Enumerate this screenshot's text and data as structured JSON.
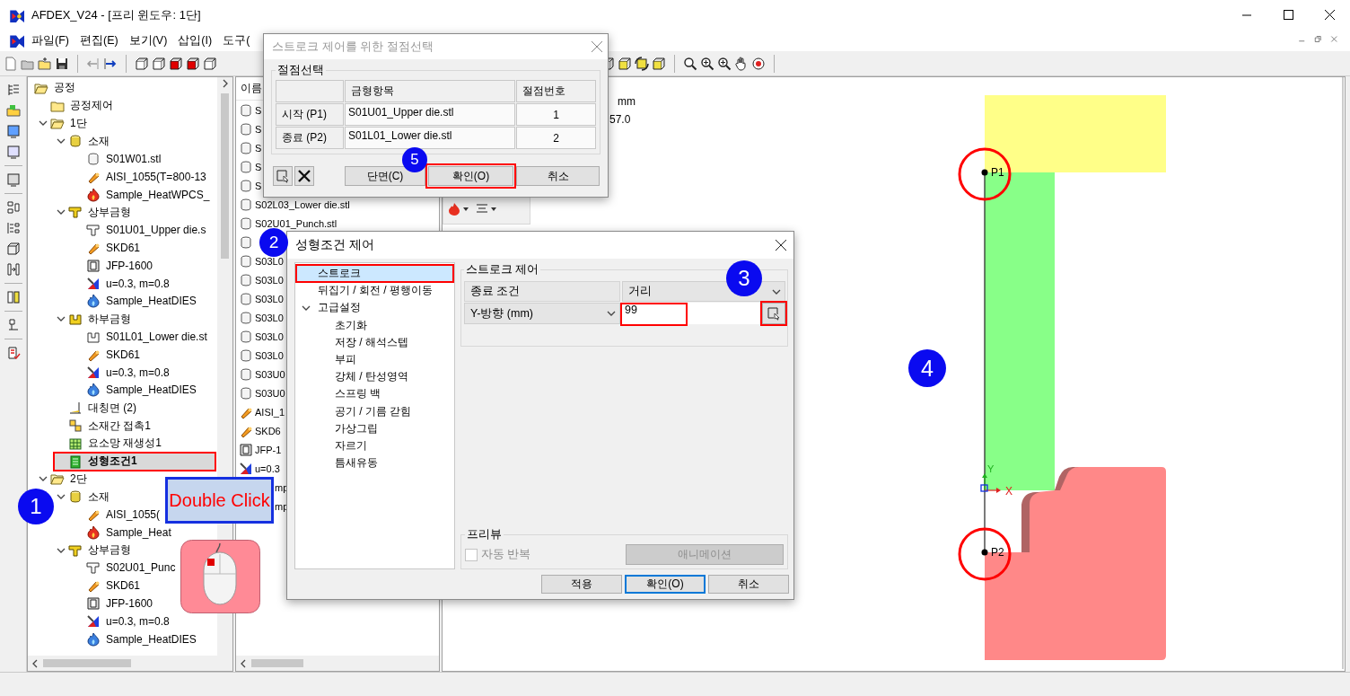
{
  "window": {
    "title": "AFDEX_V24 - [프리 윈도우: 1단]"
  },
  "menu": [
    {
      "label": "파일(F)"
    },
    {
      "label": "편집(E)"
    },
    {
      "label": "보기(V)"
    },
    {
      "label": "삽입(I)"
    },
    {
      "label": "도구("
    }
  ],
  "process_tree": {
    "items": [
      {
        "label": "공정",
        "kind": "folder",
        "selected": false,
        "highlighted": false,
        "expanded": true,
        "children": [
          {
            "label": "공정제어",
            "kind": "folder",
            "selected": false,
            "highlighted": false
          },
          {
            "label": "1단",
            "kind": "folder",
            "selected": false,
            "highlighted": false,
            "expanded": true,
            "children": [
              {
                "label": "소재",
                "kind": "solid",
                "selected": false,
                "highlighted": false,
                "expanded": true,
                "children": [
                  {
                    "label": "S01W01.stl",
                    "kind": "stl",
                    "selected": false,
                    "highlighted": false
                  },
                  {
                    "label": "AISI_1055(T=800-13",
                    "kind": "material",
                    "selected": false,
                    "highlighted": false
                  },
                  {
                    "label": "Sample_HeatWPCS_",
                    "kind": "heat",
                    "selected": false,
                    "highlighted": false
                  }
                ]
              },
              {
                "label": "상부금형",
                "kind": "upper-die",
                "selected": false,
                "highlighted": false,
                "expanded": true,
                "children": [
                  {
                    "label": "S01U01_Upper die.s",
                    "kind": "upper-part",
                    "selected": false,
                    "highlighted": false
                  },
                  {
                    "label": "SKD61",
                    "kind": "material",
                    "selected": false,
                    "highlighted": false
                  },
                  {
                    "label": "JFP-1600",
                    "kind": "press",
                    "selected": false,
                    "highlighted": false
                  },
                  {
                    "label": "u=0.3, m=0.8",
                    "kind": "friction",
                    "selected": false,
                    "highlighted": false
                  },
                  {
                    "label": "Sample_HeatDIES",
                    "kind": "heat-die",
                    "selected": false,
                    "highlighted": false
                  }
                ]
              },
              {
                "label": "하부금형",
                "kind": "lower-die",
                "selected": false,
                "highlighted": false,
                "expanded": true,
                "children": [
                  {
                    "label": "S01L01_Lower die.st",
                    "kind": "lower-part",
                    "selected": false,
                    "highlighted": false
                  },
                  {
                    "label": "SKD61",
                    "kind": "material",
                    "selected": false,
                    "highlighted": false
                  },
                  {
                    "label": "u=0.3, m=0.8",
                    "kind": "friction",
                    "selected": false,
                    "highlighted": false
                  },
                  {
                    "label": "Sample_HeatDIES",
                    "kind": "heat-die",
                    "selected": false,
                    "highlighted": false
                  }
                ]
              },
              {
                "label": "대칭면 (2)",
                "kind": "symmetry",
                "selected": false,
                "highlighted": false
              },
              {
                "label": "소재간 접촉1",
                "kind": "contact",
                "selected": false,
                "highlighted": false
              },
              {
                "label": "요소망 재생성1",
                "kind": "remesh",
                "selected": false,
                "highlighted": false
              },
              {
                "label": "성형조건1",
                "kind": "condition",
                "selected": true,
                "highlighted": true
              }
            ]
          },
          {
            "label": "2단",
            "kind": "folder",
            "selected": false,
            "highlighted": false,
            "expanded": true,
            "children": [
              {
                "label": "소재",
                "kind": "solid",
                "selected": false,
                "highlighted": false,
                "expanded": true,
                "children": [
                  {
                    "label": "AISI_1055(",
                    "kind": "material",
                    "selected": false,
                    "highlighted": false
                  },
                  {
                    "label": "Sample_Heat",
                    "kind": "heat",
                    "selected": false,
                    "highlighted": false
                  }
                ]
              },
              {
                "label": "상부금형",
                "kind": "upper-die",
                "selected": false,
                "highlighted": false,
                "expanded": true,
                "children": [
                  {
                    "label": "S02U01_Punc",
                    "kind": "upper-part",
                    "selected": false,
                    "highlighted": false
                  },
                  {
                    "label": "SKD61",
                    "kind": "material",
                    "selected": false,
                    "highlighted": false
                  },
                  {
                    "label": "JFP-1600",
                    "kind": "press",
                    "selected": false,
                    "highlighted": false
                  },
                  {
                    "label": "u=0.3, m=0.8",
                    "kind": "friction",
                    "selected": false,
                    "highlighted": false
                  },
                  {
                    "label": "Sample_HeatDIES",
                    "kind": "heat-die",
                    "selected": false,
                    "highlighted": false
                  }
                ]
              }
            ]
          }
        ]
      }
    ]
  },
  "file_list": {
    "header": "이름",
    "rows": [
      {
        "label": "S",
        "kind": "stl"
      },
      {
        "label": "S",
        "kind": "stl"
      },
      {
        "label": "S",
        "kind": "stl"
      },
      {
        "label": "S",
        "kind": "stl"
      },
      {
        "label": "S",
        "kind": "stl"
      },
      {
        "label": "S02L03_Lower die.stl",
        "kind": "stl"
      },
      {
        "label": "S02U01_Punch.stl",
        "kind": "stl"
      },
      {
        "kind": "stl"
      },
      {
        "label": "S03L0",
        "kind": "stl"
      },
      {
        "label": "S03L0",
        "kind": "stl"
      },
      {
        "label": "S03L0",
        "kind": "stl"
      },
      {
        "label": "S03L0",
        "kind": "stl"
      },
      {
        "label": "S03L0",
        "kind": "stl"
      },
      {
        "label": "S03L0",
        "kind": "stl"
      },
      {
        "label": "S03U0",
        "kind": "stl"
      },
      {
        "label": "S03U0",
        "kind": "stl"
      },
      {
        "label": "AISI_1",
        "kind": "material"
      },
      {
        "label": "SKD6",
        "kind": "material"
      },
      {
        "label": "JFP-1",
        "kind": "press"
      },
      {
        "label": "u=0.3",
        "kind": "friction"
      },
      {
        "label": "mp",
        "kind": "covered"
      },
      {
        "label": "mp",
        "kind": "covered"
      }
    ]
  },
  "property_fragment": {
    "unit": "mm",
    "value": "57.0"
  },
  "node_dialog": {
    "title": "스트로크 제어를 위한 절점선택",
    "group": "절점선택",
    "columns": [
      "금형항목",
      "절점번호"
    ],
    "rows": [
      {
        "label": "시작 (P1)",
        "die": "S01U01_Upper die.stl",
        "node": "1"
      },
      {
        "label": "종료 (P2)",
        "die": "S01L01_Lower die.stl",
        "node": "2"
      }
    ],
    "buttons": [
      {
        "label": "단면(C)",
        "highlighted": false
      },
      {
        "label": "확인(O)",
        "highlighted": true
      },
      {
        "label": "취소",
        "highlighted": false
      }
    ]
  },
  "condition_dialog": {
    "title": "성형조건 제어",
    "nav": [
      {
        "label": "스트로크",
        "selected": true,
        "highlighted": true
      },
      {
        "label": "뒤집기 / 회전 / 평행이동",
        "selected": false,
        "highlighted": false
      },
      {
        "label": "고급설정",
        "selected": false,
        "highlighted": false,
        "expanded": true,
        "children": [
          {
            "label": "초기화",
            "selected": false,
            "highlighted": false
          },
          {
            "label": "저장 / 해석스텝",
            "selected": false,
            "highlighted": false
          },
          {
            "label": "부피",
            "selected": false,
            "highlighted": false
          },
          {
            "label": "강체 / 탄성영역",
            "selected": false,
            "highlighted": false
          },
          {
            "label": "스프링 백",
            "selected": false,
            "highlighted": false
          },
          {
            "label": "공기 / 기름 갇힘",
            "selected": false,
            "highlighted": false
          },
          {
            "label": "가상그립",
            "selected": false,
            "highlighted": false
          },
          {
            "label": "자르기",
            "selected": false,
            "highlighted": false
          },
          {
            "label": "틈새유동",
            "selected": false,
            "highlighted": false
          }
        ]
      }
    ],
    "stroke_group": {
      "title": "스트로크 제어",
      "end_condition_label": "종료 조건",
      "end_condition": "거리",
      "direction": "Y-방향 (mm)",
      "value": "99",
      "value_highlighted": true,
      "pick_highlighted": true
    },
    "preview_group": {
      "title": "프리뷰",
      "auto_repeat": {
        "label": "자동 반복",
        "checked": false,
        "disabled": true
      },
      "animation": {
        "label": "애니메이션",
        "disabled": true
      }
    },
    "buttons": [
      {
        "label": "적용",
        "default": false
      },
      {
        "label": "확인(O)",
        "default": true
      },
      {
        "label": "취소",
        "default": false
      }
    ]
  },
  "canvas": {
    "points": [
      {
        "label": "P1",
        "highlighted": true
      },
      {
        "label": "P2",
        "highlighted": true
      }
    ],
    "axes": {
      "x": "X",
      "y": "Y"
    }
  },
  "annotations": {
    "markers": [
      {
        "label": "1"
      },
      {
        "label": "2"
      },
      {
        "label": "3"
      },
      {
        "label": "4"
      },
      {
        "label": "5"
      }
    ],
    "callout": "Double Click"
  }
}
